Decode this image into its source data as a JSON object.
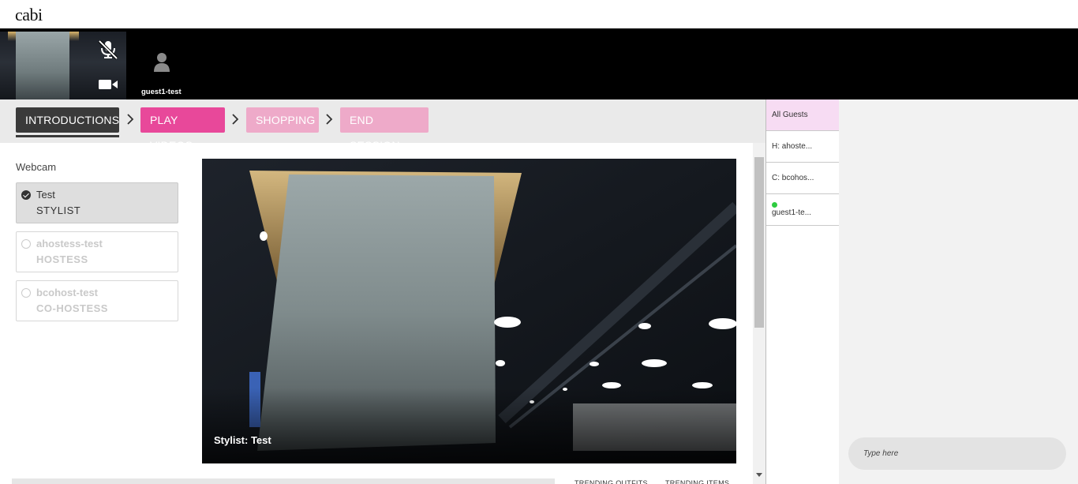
{
  "app": {
    "logo": "cabi"
  },
  "participants": {
    "self": {
      "mic_icon": "mic-off-icon",
      "camera_icon": "video-camera-icon"
    },
    "guest": {
      "name": "guest1-test",
      "icon": "user-icon"
    }
  },
  "steps": [
    {
      "label": "INTRODUCTIONS",
      "state": "current",
      "color": "#3a3a3a"
    },
    {
      "label": "PLAY VIDEOS",
      "state": "active",
      "color": "#e8489a"
    },
    {
      "label": "SHOPPING",
      "state": "pending",
      "color": "#eeaac9"
    },
    {
      "label": "END SESSION",
      "state": "pending",
      "color": "#eeaac9"
    }
  ],
  "webcam": {
    "label": "Webcam",
    "options": [
      {
        "name": "Test",
        "role": "STYLIST",
        "selected": true
      },
      {
        "name": "ahostess-test",
        "role": "HOSTESS",
        "selected": false
      },
      {
        "name": "bcohost-test",
        "role": "CO-HOSTESS",
        "selected": false
      }
    ]
  },
  "video": {
    "caption": "Stylist: Test"
  },
  "bottom_tabs": [
    "TRENDING OUTFITS",
    "TRENDING ITEMS"
  ],
  "guests": {
    "items": [
      {
        "label": "All Guests",
        "active": true
      },
      {
        "label": "H: ahoste..."
      },
      {
        "label": "C: bcohos..."
      },
      {
        "label": "guest1-te...",
        "online": true
      }
    ]
  },
  "chat": {
    "placeholder": "Type here"
  }
}
